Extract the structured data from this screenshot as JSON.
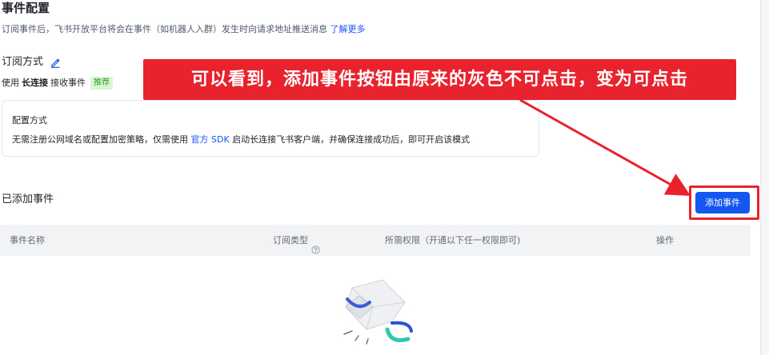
{
  "header": {
    "title": "事件配置",
    "desc": "订阅事件后，飞书开放平台将会在事件（如机器人入群）发生时向请求地址推送消息",
    "learn_more": "了解更多"
  },
  "subscription": {
    "title": "订阅方式",
    "mode_prefix": "使用",
    "mode_name": "长连接",
    "mode_suffix": "接收事件",
    "recommend_tag": "推荐"
  },
  "config_box": {
    "title": "配置方式",
    "desc_prefix": "无需注册公网域名或配置加密策略，仅需使用",
    "sdk_link": "官方 SDK",
    "desc_suffix": "启动长连接飞书客户端，并确保连接成功后，即可开启该模式"
  },
  "events": {
    "section_title": "已添加事件",
    "add_button": "添加事件",
    "columns": [
      "事件名称",
      "订阅类型",
      "所需权限（开通以下任一权限即可)",
      "操作"
    ]
  },
  "annotation": {
    "text": "可以看到，添加事件按钮由原来的灰色不可点击，变为可点击",
    "color": "#e8232d"
  },
  "colors": {
    "primary": "#1456f0",
    "annotation_red": "#e8232d",
    "tag_green_bg": "#d9f5d6",
    "tag_green_text": "#2ea121"
  },
  "icons": {
    "edit": "edit-icon",
    "help": "help-circle-icon",
    "empty": "empty-state-illustration"
  }
}
